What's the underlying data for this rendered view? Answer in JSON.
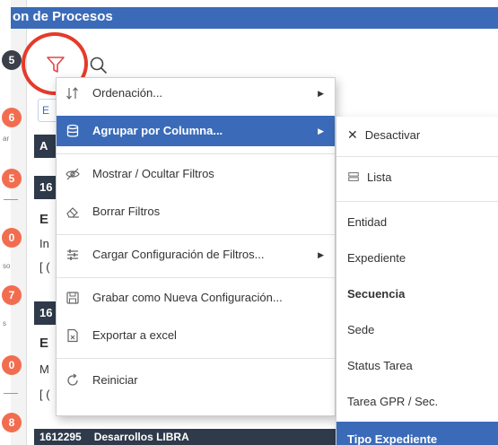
{
  "header": {
    "title": "on de Procesos"
  },
  "rail": {
    "badges": [
      "5",
      "6",
      "5",
      "0",
      "7",
      "0",
      "8"
    ],
    "labels": [
      "ar",
      "so",
      "s"
    ]
  },
  "toolbar": {
    "mini_field": "E"
  },
  "background": {
    "card_heads": [
      "A",
      "16",
      "16"
    ],
    "texts": [
      "E",
      "In",
      "[ (",
      "E",
      "M",
      "[ ("
    ],
    "bottom_bar": [
      "1612295",
      "Desarrollos LIBRA"
    ]
  },
  "menu": {
    "items": [
      {
        "label": "Ordenación...",
        "icon": "sort-icon",
        "has_submenu": true
      },
      {
        "label": "Agrupar por Columna...",
        "icon": "database-icon",
        "has_submenu": true,
        "active": true
      },
      {
        "label": "Mostrar / Ocultar Filtros",
        "icon": "eye-slash-icon",
        "has_submenu": false
      },
      {
        "label": "Borrar Filtros",
        "icon": "eraser-icon",
        "has_submenu": false
      },
      {
        "label": "Cargar Configuración de Filtros...",
        "icon": "sliders-icon",
        "has_submenu": true
      },
      {
        "label": "Grabar como Nueva Configuración...",
        "icon": "save-icon",
        "has_submenu": false
      },
      {
        "label": "Exportar a excel",
        "icon": "file-excel-icon",
        "has_submenu": false
      },
      {
        "label": "Reiniciar",
        "icon": "reset-icon",
        "has_submenu": false
      }
    ]
  },
  "submenu": {
    "items": [
      {
        "label": "Desactivar",
        "icon": "close-icon"
      },
      {
        "label": "Lista",
        "icon": "list-icon"
      },
      {
        "label": "Entidad"
      },
      {
        "label": "Expediente"
      },
      {
        "label": "Secuencia",
        "bold": true
      },
      {
        "label": "Sede"
      },
      {
        "label": "Status Tarea"
      },
      {
        "label": "Tarea GPR / Sec."
      },
      {
        "label": "Tipo Expediente",
        "active": true
      }
    ]
  },
  "colors": {
    "accent": "#3b6bb8",
    "dark_bar": "#2f3a4a",
    "badge": "#f26d4f",
    "highlight_circle": "#e53a2b"
  }
}
